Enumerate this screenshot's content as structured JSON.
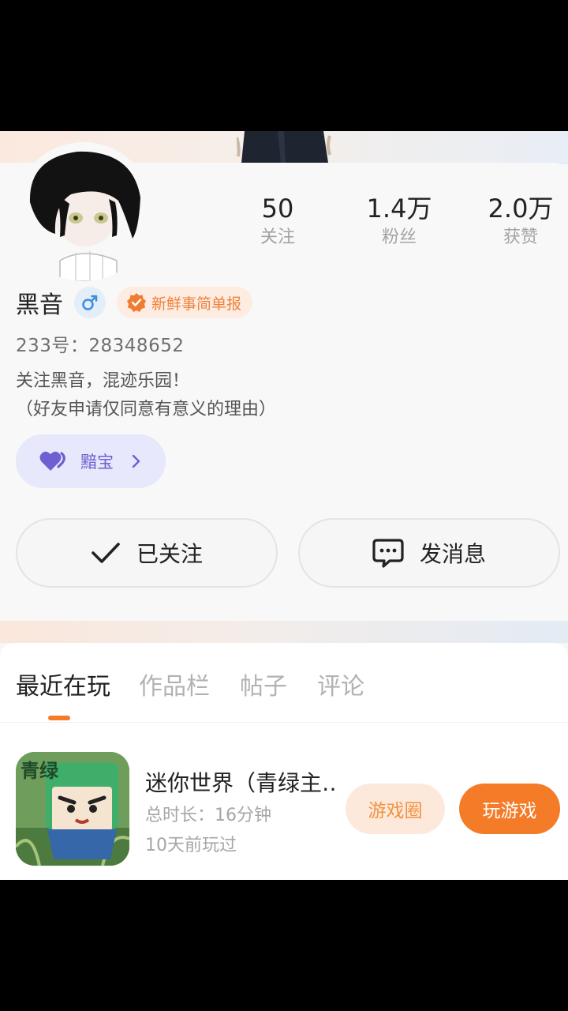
{
  "stats": [
    {
      "value": "50",
      "label": "关注"
    },
    {
      "value": "1.4万",
      "label": "粉丝"
    },
    {
      "value": "2.0万",
      "label": "获赞"
    }
  ],
  "profile": {
    "name": "黑音",
    "gender_icon": "male-icon",
    "badge": "新鲜事简单报",
    "uid": "233号：28348652",
    "bio_line1": "关注黑音，混迹乐园！",
    "bio_line2": "（好友申请仅同意有意义的理由）",
    "treasure_label": "黯宝"
  },
  "actions": {
    "follow_label": "已关注",
    "message_label": "发消息"
  },
  "tabs": [
    {
      "label": "最近在玩",
      "active": true
    },
    {
      "label": "作品栏",
      "active": false
    },
    {
      "label": "帖子",
      "active": false
    },
    {
      "label": "评论",
      "active": false
    }
  ],
  "games": [
    {
      "title": "迷你世界（青绿主…",
      "icon_text": "青绿",
      "duration": "总时长：16分钟",
      "last_played": "10天前玩过",
      "circle_label": "游戏圈",
      "play_label": "玩游戏"
    }
  ],
  "colors": {
    "accent": "#f47b27",
    "badge_bg": "#fcece2",
    "treasure_bg": "#e7e8fb",
    "treasure_text": "#6e5fd2"
  }
}
